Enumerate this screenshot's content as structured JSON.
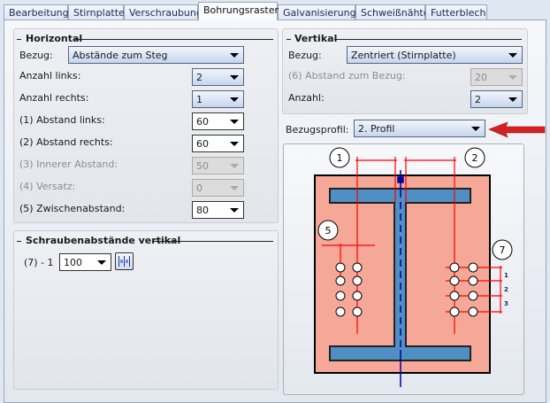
{
  "tabs": [
    {
      "label": "Bearbeitung"
    },
    {
      "label": "Stirnplatte"
    },
    {
      "label": "Verschraubung"
    },
    {
      "label": "Bohrungsraster",
      "active": true
    },
    {
      "label": "Galvanisierung"
    },
    {
      "label": "Schweißnähte"
    },
    {
      "label": "Futterblech"
    }
  ],
  "horizontal": {
    "title": "Horizontal",
    "bezug_label": "Bezug:",
    "bezug_value": "Abstände zum Steg",
    "fields": [
      {
        "label": "Anzahl links:",
        "value": "2",
        "enabled": true
      },
      {
        "label": "Anzahl rechts:",
        "value": "1",
        "enabled": true
      },
      {
        "label": "(1) Abstand links:",
        "value": "60",
        "enabled": true
      },
      {
        "label": "(2) Abstand rechts:",
        "value": "60",
        "enabled": true
      },
      {
        "label": "(3) Innerer Abstand:",
        "value": "50",
        "enabled": false
      },
      {
        "label": "(4) Versatz:",
        "value": "0",
        "enabled": false
      },
      {
        "label": "(5) Zwischenabstand:",
        "value": "80",
        "enabled": true
      }
    ]
  },
  "schrauben": {
    "title": "Schraubenabstände vertikal",
    "row_label": "(7) - 1",
    "row_value": "100",
    "equal_icon": "equal-spacing-icon"
  },
  "vertikal": {
    "title": "Vertikal",
    "bezug_label": "Bezug:",
    "bezug_value": "Zentriert (Stirnplatte)",
    "abstand_label": "(6) Abstand zum Bezug:",
    "abstand_value": "20",
    "abstand_enabled": false,
    "anzahl_label": "Anzahl:",
    "anzahl_value": "2"
  },
  "bezugsprofil": {
    "label": "Bezugsprofil:",
    "value": "2. Profil"
  },
  "diagram": {
    "callouts": [
      "1",
      "2",
      "5",
      "7"
    ],
    "spacing_labels": [
      "1",
      "2",
      "3"
    ],
    "colors": {
      "plate": "#f5a898",
      "profile": "#4f8fc4",
      "dimension": "#ff0000",
      "axis": "#0000a0",
      "pointer_arrow": "#d42020"
    }
  }
}
